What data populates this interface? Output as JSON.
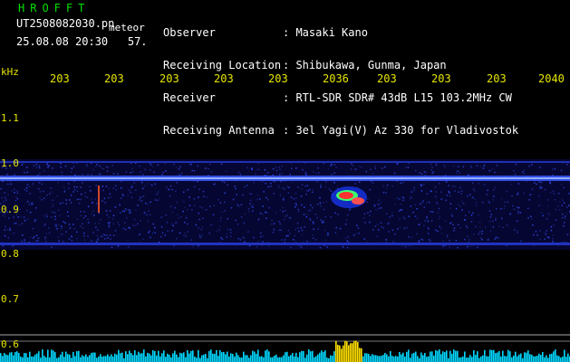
{
  "header": {
    "brand": "HROFFT",
    "filename": "UT2508082030.pn",
    "mode": "meteor",
    "datetime": "25.08.08 20:30",
    "count": "57.",
    "labels": [
      "Observer",
      "Receiving Location",
      "Receiver",
      "Receiving Antenna"
    ],
    "values": [
      ": Masaki Kano",
      ": Shibukawa, Gunma, Japan",
      ": RTL-SDR SDR# 43dB L15 103.2MHz CW",
      ": 3el Yagi(V) Az 330 for Vladivostok"
    ]
  },
  "axis": {
    "unit": "kHz",
    "x_ticks": [
      "203",
      "203",
      "203",
      "203",
      "203",
      "2036",
      "203",
      "203",
      "203",
      "2040"
    ],
    "y_ticks": [
      "1.1",
      "1.0",
      "0.9",
      "0.8",
      "0.7",
      "0.6"
    ]
  },
  "colors": {
    "text": "#ffffff",
    "axis": "#e6e600",
    "brand": "#00e000",
    "noise": "#1a1aa0",
    "signal": "#ff3030",
    "level": "#00e0ff"
  }
}
